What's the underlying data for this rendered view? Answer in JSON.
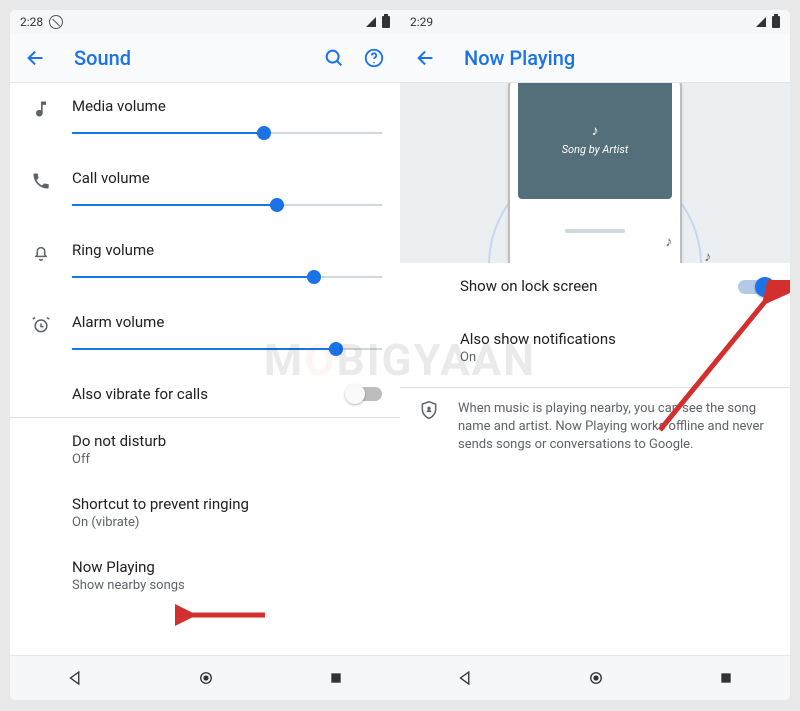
{
  "left": {
    "time": "2:28",
    "title": "Sound",
    "rows": {
      "media": {
        "label": "Media volume",
        "pct": 62
      },
      "call": {
        "label": "Call volume",
        "pct": 66
      },
      "ring": {
        "label": "Ring volume",
        "pct": 78
      },
      "alarm": {
        "label": "Alarm volume",
        "pct": 85
      }
    },
    "vibrate": {
      "label": "Also vibrate for calls"
    },
    "dnd": {
      "label": "Do not disturb",
      "sub": "Off"
    },
    "shortcut": {
      "label": "Shortcut to prevent ringing",
      "sub": "On (vibrate)"
    },
    "nowplaying": {
      "label": "Now Playing",
      "sub": "Show nearby songs"
    }
  },
  "right": {
    "time": "2:29",
    "title": "Now Playing",
    "illus_caption": "Song by Artist",
    "lockscreen": {
      "label": "Show on lock screen"
    },
    "notif": {
      "label": "Also show notifications",
      "sub": "On"
    },
    "info": "When music is playing nearby, you can see the song name and artist. Now Playing works offline and never sends songs or conversations to Google."
  },
  "watermark": {
    "pre": "M",
    "o": "O",
    "post": "BIGYAAN"
  }
}
